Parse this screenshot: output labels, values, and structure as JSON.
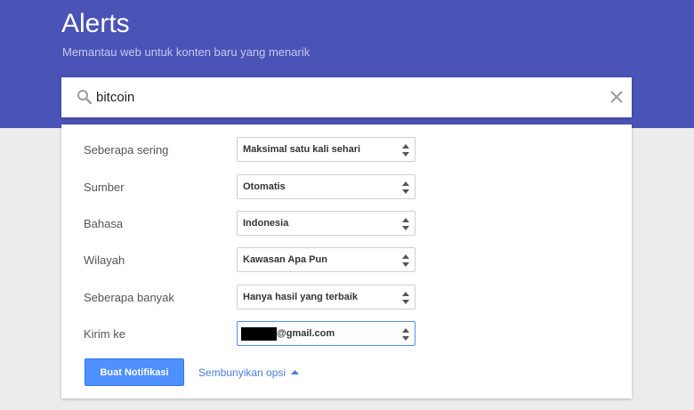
{
  "header": {
    "title": "Alerts",
    "subtitle": "Memantau web untuk konten baru yang menarik"
  },
  "search": {
    "query": "bitcoin",
    "icon": "search-icon",
    "clear_icon": "close-icon"
  },
  "options": [
    {
      "label": "Seberapa sering",
      "value": "Maksimal satu kali sehari"
    },
    {
      "label": "Sumber",
      "value": "Otomatis"
    },
    {
      "label": "Bahasa",
      "value": "Indonesia"
    },
    {
      "label": "Wilayah",
      "value": "Kawasan Apa Pun"
    },
    {
      "label": "Seberapa banyak",
      "value": "Hanya hasil yang terbaik"
    }
  ],
  "delivery": {
    "label": "Kirim ke",
    "email_suffix": "@gmail.com"
  },
  "actions": {
    "create_label": "Buat Notifikasi",
    "hide_options_label": "Sembunyikan opsi"
  },
  "colors": {
    "header": "#4a53b6",
    "primary": "#4d90fe",
    "link": "#4a7ed9"
  }
}
